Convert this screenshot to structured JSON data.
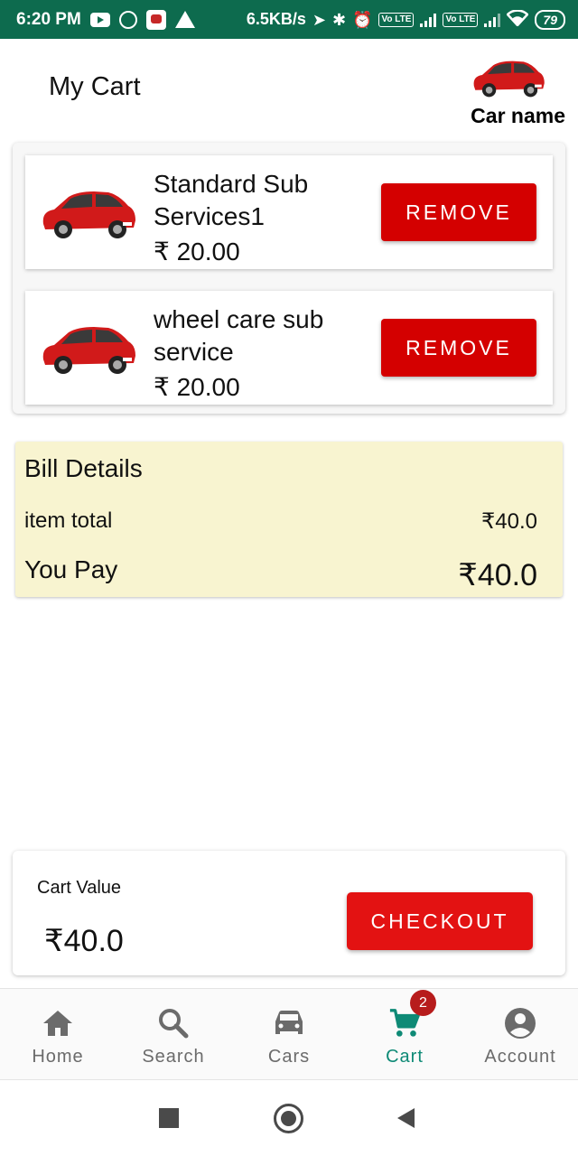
{
  "status_bar": {
    "time": "6:20 PM",
    "net_speed": "6.5KB/s",
    "battery": "79",
    "volte1": "Vo LTE",
    "volte2": "Vo LTE"
  },
  "header": {
    "title": "My Cart",
    "car_label": "Car name"
  },
  "cart_items": [
    {
      "name": "Standard Sub Services1",
      "price": "₹ 20.00",
      "remove_label": "REMOVE"
    },
    {
      "name": "wheel care sub service",
      "price": "₹ 20.00",
      "remove_label": "REMOVE"
    }
  ],
  "bill": {
    "title": "Bill Details",
    "item_total_label": "item total",
    "item_total_value": "₹40.0",
    "you_pay_label": "You Pay",
    "you_pay_value": "₹40.0"
  },
  "cart_value": {
    "label": "Cart Value",
    "value": "₹40.0",
    "checkout_label": "CHECKOUT"
  },
  "bottom_nav": {
    "items": [
      {
        "label": "Home",
        "icon": "home-icon"
      },
      {
        "label": "Search",
        "icon": "search-icon"
      },
      {
        "label": "Cars",
        "icon": "car-icon"
      },
      {
        "label": "Cart",
        "icon": "cart-icon",
        "badge": "2",
        "active": true
      },
      {
        "label": "Account",
        "icon": "account-icon"
      }
    ]
  },
  "colors": {
    "status_bar": "#0d6b4e",
    "remove": "#d40000",
    "checkout": "#e31212",
    "bill_bg": "#f8f4d0",
    "nav_active": "#0e8a76",
    "badge": "#b71c1c"
  }
}
